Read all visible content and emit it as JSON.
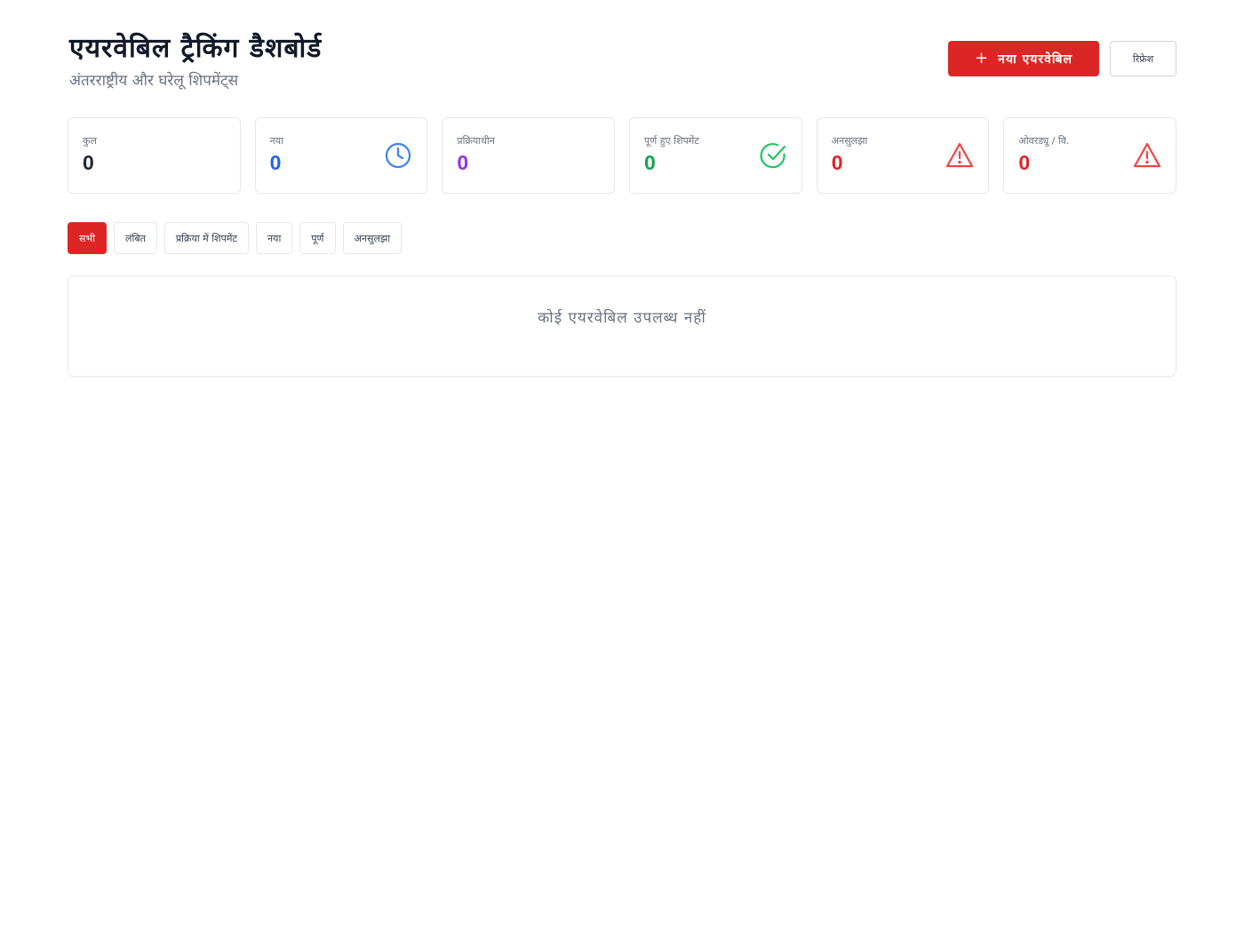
{
  "header": {
    "title": "एयरवेबिल ट्रैकिंग डैशबोर्ड",
    "subtitle": "अंतरराष्ट्रीय और घरेलू शिपमेंट्स",
    "new_button_label": "नया एयरवेबिल",
    "secondary_button_label": "रिफ्रेश"
  },
  "stats": [
    {
      "label": "कुल",
      "value": "0",
      "icon": "none",
      "color": "#1f2937"
    },
    {
      "label": "नया",
      "value": "0",
      "icon": "clock-icon",
      "color": "#2563eb"
    },
    {
      "label": "प्रक्रियाधीन",
      "value": "0",
      "icon": "none",
      "color": "#9333ea"
    },
    {
      "label": "पूर्ण हुए शिपमेंट",
      "value": "0",
      "icon": "check-circle-icon",
      "color": "#16a34a"
    },
    {
      "label": "अनसुलझा",
      "value": "0",
      "icon": "warning-icon",
      "color": "#dc2626"
    },
    {
      "label": "ओवरड्यू / वि.",
      "value": "0",
      "icon": "warning-icon",
      "color": "#dc2626"
    }
  ],
  "filters": [
    {
      "label": "सभी",
      "active": true
    },
    {
      "label": "लंबित",
      "active": false
    },
    {
      "label": "प्रक्रिया में शिपमेंट",
      "active": false
    },
    {
      "label": "नया",
      "active": false
    },
    {
      "label": "पूर्ण",
      "active": false
    },
    {
      "label": "अनसुलझा",
      "active": false
    }
  ],
  "empty_state": {
    "message": "कोई एयरवेबिल उपलब्ध नहीं"
  },
  "colors": {
    "accent": "#dc2626",
    "blue": "#2563eb",
    "purple": "#9333ea",
    "green": "#16a34a"
  }
}
